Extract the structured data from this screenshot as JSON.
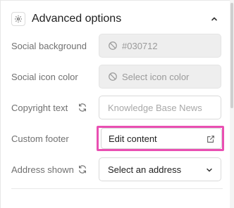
{
  "section": {
    "title": "Advanced options",
    "header_icon": "gear-icon",
    "collapse_icon": "chevron-up-icon"
  },
  "rows": {
    "social_background": {
      "label": "Social background",
      "value": "#030712",
      "state": "disabled",
      "icon": "ban-icon"
    },
    "social_icon_color": {
      "label": "Social icon color",
      "placeholder": "Select icon color",
      "state": "disabled",
      "icon": "ban-icon"
    },
    "copyright_text": {
      "label": "Copyright text",
      "placeholder": "Knowledge Base News",
      "sync_icon": "sync-icon"
    },
    "custom_footer": {
      "label": "Custom footer",
      "button_label": "Edit content",
      "button_icon": "external-link-icon"
    },
    "address_shown": {
      "label": "Address shown",
      "selected": "Select an address",
      "sync_icon": "sync-icon",
      "dropdown_icon": "chevron-down-icon"
    }
  },
  "colors": {
    "highlight": "#e94fb2",
    "label": "#707070",
    "disabled_bg": "#eeeeee"
  }
}
